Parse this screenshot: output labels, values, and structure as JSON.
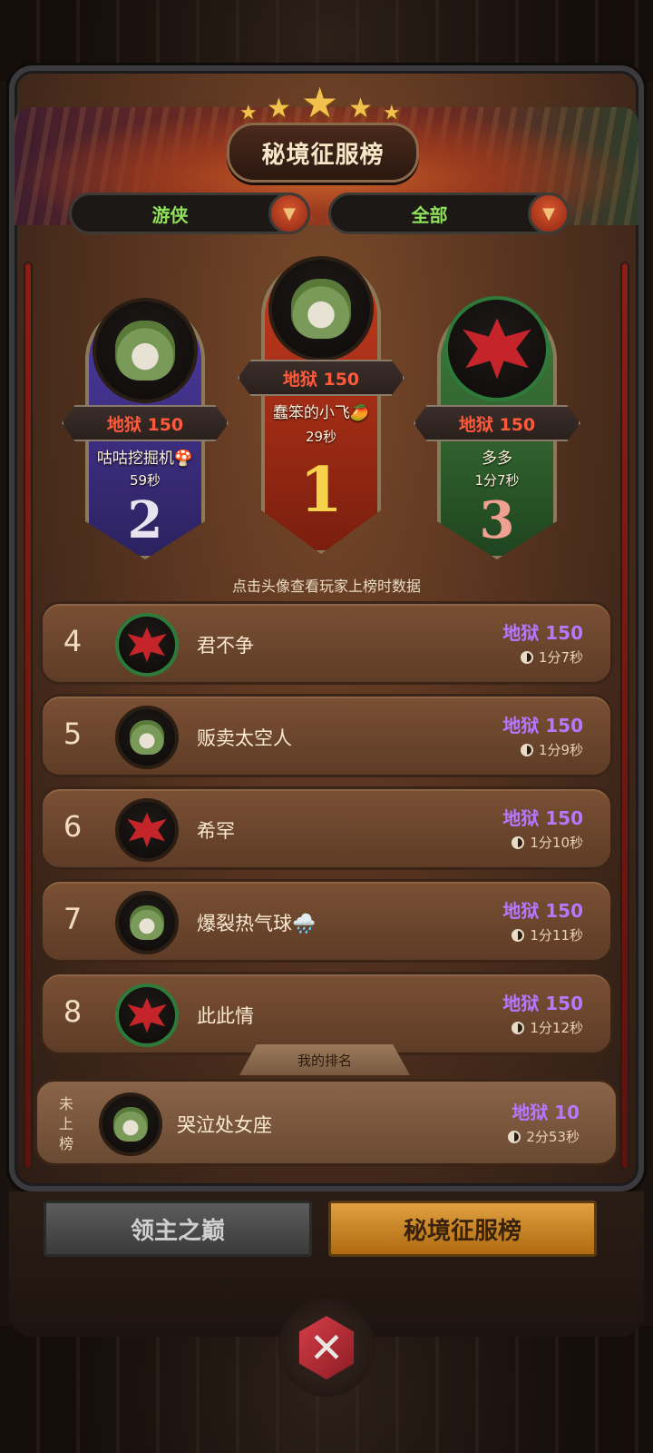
{
  "title": "秘境征服榜",
  "filters": {
    "class_label": "游侠",
    "scope_label": "全部"
  },
  "podium": [
    {
      "rank": "1",
      "level": "地狱 150",
      "name": "蠢笨的小飞🥭",
      "time": "29秒",
      "avatar": "fox-icon"
    },
    {
      "rank": "2",
      "level": "地狱 150",
      "name": "咕咕挖掘机🍄",
      "time": "59秒",
      "avatar": "fox-icon"
    },
    {
      "rank": "3",
      "level": "地狱 150",
      "name": "多多",
      "time": "1分7秒",
      "avatar": "dragon-icon"
    }
  ],
  "hint": "点击头像查看玩家上榜时数据",
  "list": [
    {
      "rank": "4",
      "name": "君不争",
      "level": "地狱 150",
      "time": "1分7秒",
      "avatar": "dragon-icon"
    },
    {
      "rank": "5",
      "name": "贩卖太空人",
      "level": "地狱 150",
      "time": "1分9秒",
      "avatar": "fox-icon"
    },
    {
      "rank": "6",
      "name": "希罕",
      "level": "地狱 150",
      "time": "1分10秒",
      "avatar": "dragon-icon"
    },
    {
      "rank": "7",
      "name": "爆裂热气球🌧️",
      "level": "地狱 150",
      "time": "1分11秒",
      "avatar": "fox-icon"
    },
    {
      "rank": "8",
      "name": "此此情",
      "level": "地狱 150",
      "time": "1分12秒",
      "avatar": "dragon-icon"
    }
  ],
  "my_rank": {
    "tab_label": "我的排名",
    "status": "未上榜",
    "name": "哭泣处女座",
    "level": "地狱 10",
    "time": "2分53秒",
    "avatar": "fox-icon"
  },
  "tabs": [
    {
      "label": "领主之巅",
      "active": false
    },
    {
      "label": "秘境征服榜",
      "active": true
    }
  ],
  "colors": {
    "level_purple": "#b777ff",
    "level_red": "#ff5a3c",
    "filter_green": "#8fe05a",
    "active_tab": "#e0a040"
  }
}
